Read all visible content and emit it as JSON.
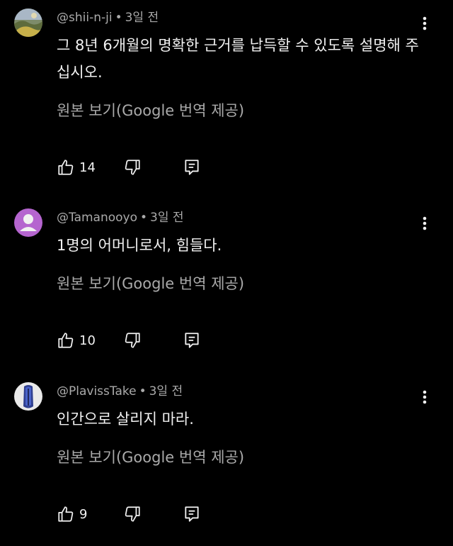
{
  "colors": {
    "background": "#000000",
    "primary_text": "#f1f1f1",
    "secondary_text": "#aaaaaa",
    "icon": "#f1f1f1",
    "default_avatar": "#b565cf"
  },
  "comments": [
    {
      "author": "@shii-n-ji",
      "separator": "•",
      "time": "3일 전",
      "text": "그 8년 6개월의 명확한 근거를 납득할 수 있도록 설명해 주십시오.",
      "translate_label": "원본 보기(Google 번역 제공)",
      "like_count": "14",
      "icons": {
        "like": "thumbs-up-icon",
        "dislike": "thumbs-down-icon",
        "reply": "reply-icon",
        "menu": "more-vert-icon"
      }
    },
    {
      "author": "@Tamanooyo",
      "separator": "•",
      "time": "3일 전",
      "text": "1명의 어머니로서, 힘들다.",
      "translate_label": "원본 보기(Google 번역 제공)",
      "like_count": "10",
      "icons": {
        "like": "thumbs-up-icon",
        "dislike": "thumbs-down-icon",
        "reply": "reply-icon",
        "menu": "more-vert-icon"
      }
    },
    {
      "author": "@PlavissTake",
      "separator": "•",
      "time": "3일 전",
      "text": "인간으로 살리지 마라.",
      "translate_label": "원본 보기(Google 번역 제공)",
      "like_count": "9",
      "icons": {
        "like": "thumbs-up-icon",
        "dislike": "thumbs-down-icon",
        "reply": "reply-icon",
        "menu": "more-vert-icon"
      }
    }
  ]
}
